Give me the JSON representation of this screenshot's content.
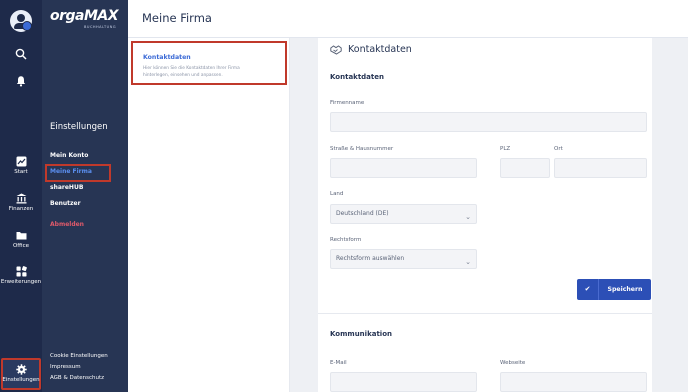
{
  "rail": {
    "items": [
      {
        "label": "Start",
        "icon": "chart-icon"
      },
      {
        "label": "Finanzen",
        "icon": "bank-icon"
      },
      {
        "label": "Office",
        "icon": "folder-icon"
      },
      {
        "label": "Erweiterungen",
        "icon": "extensions-icon"
      },
      {
        "label": "Einstellungen",
        "icon": "gear-icon"
      }
    ]
  },
  "brand": {
    "name": "orgaMAX",
    "sub": "BUCHHALTUNG"
  },
  "sidebar": {
    "title": "Einstellungen",
    "links": [
      "Mein Konto",
      "Meine Firma",
      "shareHUB",
      "Benutzer",
      "Abmelden"
    ],
    "footer": [
      "Cookie Einstellungen",
      "Impressum",
      "AGB & Datenschutz"
    ]
  },
  "header": {
    "title": "Meine Firma"
  },
  "subnav": {
    "title": "Kontaktdaten",
    "description": "Hier können Sie die Kontaktdaten Ihrer Firma hinterlegen, einsehen und anpassen."
  },
  "form": {
    "card_title": "Kontaktdaten",
    "section1": "Kontaktdaten",
    "firmenname_label": "Firmenname",
    "strasse_label": "Straße & Hausnummer",
    "plz_label": "PLZ",
    "ort_label": "Ort",
    "land_label": "Land",
    "land_value": "Deutschland (DE)",
    "rechtsform_label": "Rechtsform",
    "rechtsform_value": "Rechtsform auswählen",
    "save_label": "Speichern",
    "section2": "Kommunikation",
    "email_label": "E-Mail",
    "webseite_label": "Webseite"
  },
  "colors": {
    "accent": "#3b6ad6",
    "sidebar": "#273554",
    "rail": "#1e2a4a",
    "highlight": "#c0392b",
    "button": "#2c4fb6"
  }
}
